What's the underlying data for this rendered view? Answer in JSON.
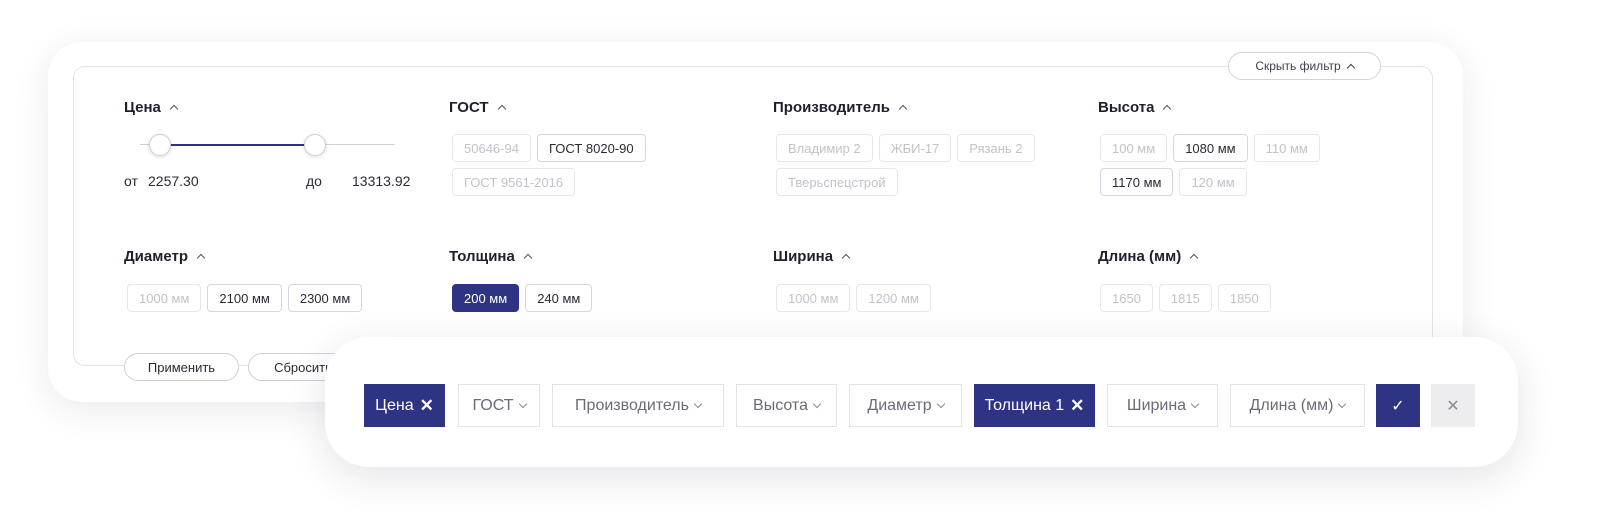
{
  "filter_panel": {
    "hide_label": "Скрыть фильтр",
    "price": {
      "title": "Цена",
      "from_label": "от",
      "from_value": "2257.30",
      "to_label": "до",
      "to_value": "13313.92"
    },
    "gost": {
      "title": "ГОСТ",
      "options": [
        {
          "label": "50646-94",
          "state": "disabled"
        },
        {
          "label": "ГОСТ 8020-90",
          "state": "available"
        },
        {
          "label": "ГОСТ 9561-2016",
          "state": "disabled"
        }
      ]
    },
    "manufacturer": {
      "title": "Производитель",
      "options": [
        {
          "label": "Владимир 2",
          "state": "disabled"
        },
        {
          "label": "ЖБИ-17",
          "state": "disabled"
        },
        {
          "label": "Рязань 2",
          "state": "disabled"
        },
        {
          "label": "Тверьспецстрой",
          "state": "disabled"
        }
      ]
    },
    "height": {
      "title": "Высота",
      "options": [
        {
          "label": "100 мм",
          "state": "disabled"
        },
        {
          "label": "1080 мм",
          "state": "available"
        },
        {
          "label": "110 мм",
          "state": "disabled"
        },
        {
          "label": "1170 мм",
          "state": "available"
        },
        {
          "label": "120 мм",
          "state": "disabled"
        }
      ]
    },
    "diameter": {
      "title": "Диаметр",
      "options": [
        {
          "label": "1000 мм",
          "state": "disabled"
        },
        {
          "label": "2100 мм",
          "state": "available"
        },
        {
          "label": "2300 мм",
          "state": "available"
        }
      ]
    },
    "thickness": {
      "title": "Толщина",
      "options": [
        {
          "label": "200 мм",
          "state": "active"
        },
        {
          "label": "240 мм",
          "state": "available"
        }
      ]
    },
    "width": {
      "title": "Ширина",
      "options": [
        {
          "label": "1000 мм",
          "state": "disabled"
        },
        {
          "label": "1200 мм",
          "state": "disabled"
        }
      ]
    },
    "length": {
      "title": "Длина (мм)",
      "options": [
        {
          "label": "1650",
          "state": "disabled"
        },
        {
          "label": "1815",
          "state": "disabled"
        },
        {
          "label": "1850",
          "state": "disabled"
        }
      ]
    },
    "apply_label": "Применить",
    "reset_label": "Сбросить"
  },
  "filter_bar": {
    "items": [
      {
        "label": "Цена",
        "active": true
      },
      {
        "label": "ГОСТ",
        "active": false
      },
      {
        "label": "Производитель",
        "active": false
      },
      {
        "label": "Высота",
        "active": false
      },
      {
        "label": "Диаметр",
        "active": false
      },
      {
        "label": "Толщина 1",
        "active": true
      },
      {
        "label": "Ширина",
        "active": false
      },
      {
        "label": "Длина (мм)",
        "active": false
      }
    ],
    "confirm_icon": "check-icon",
    "cancel_icon": "close-icon"
  },
  "colors": {
    "accent": "#2e3483",
    "disabled_text": "#c2c2cb",
    "border": "#e2e2e8"
  }
}
